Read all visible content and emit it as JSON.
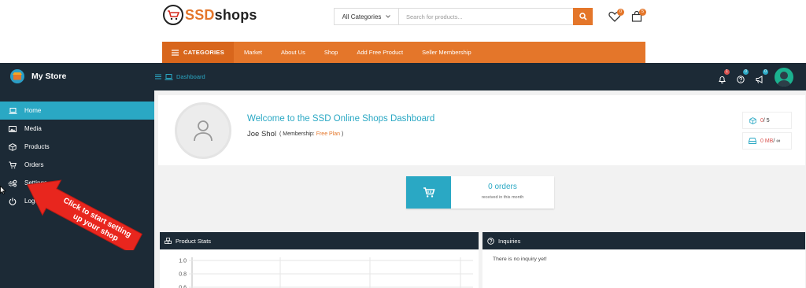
{
  "brand": {
    "part1": "SSD",
    "part2": "shops"
  },
  "search": {
    "category": "All Categories",
    "placeholder": "Search for products..."
  },
  "header_icons": [
    {
      "name": "wishlist-heart-icon",
      "badge": "0"
    },
    {
      "name": "cart-bag-icon",
      "badge": "5"
    }
  ],
  "nav": {
    "categories_label": "CATEGORIES",
    "items": [
      "Market",
      "About Us",
      "Shop",
      "Add Free Product",
      "Seller Membership"
    ]
  },
  "app": {
    "store_name": "My Store",
    "breadcrumb": "Dashboard",
    "notification_icons": [
      {
        "name": "bell-icon",
        "badge": "1",
        "color": "#d9534f"
      },
      {
        "name": "help-icon",
        "badge": "0",
        "color": "#2aa8c4"
      },
      {
        "name": "megaphone-icon",
        "badge": "0",
        "color": "#2aa8c4"
      }
    ]
  },
  "sidebar": {
    "items": [
      {
        "label": "Home",
        "icon": "laptop-icon",
        "active": true
      },
      {
        "label": "Media",
        "icon": "image-icon"
      },
      {
        "label": "Products",
        "icon": "box-icon"
      },
      {
        "label": "Orders",
        "icon": "cart-icon"
      },
      {
        "label": "Settings",
        "icon": "gears-icon"
      },
      {
        "label": "Logout",
        "icon": "power-icon"
      }
    ]
  },
  "callout": {
    "line1": "Click to start setting",
    "line2": "up your shop"
  },
  "welcome": {
    "title": "Welcome to the SSD Online Shops Dashboard",
    "name": "Joe Shol",
    "membership_prefix": "( Membership: ",
    "plan": "Free Plan",
    "membership_suffix": " )"
  },
  "stats": {
    "products_used": "0",
    "products_total": " / 5",
    "storage_used": "0 MB",
    "storage_total": " / ∞"
  },
  "orders": {
    "count": "0 orders",
    "subtitle": "received in this month"
  },
  "product_stats": {
    "title": "Product Stats"
  },
  "inquiries": {
    "title": "Inquiries",
    "empty_text": "There is no inquiry yet!"
  },
  "chart_data": {
    "type": "line",
    "y_ticks": [
      "1.0",
      "0.8",
      "0.6"
    ],
    "ylim": [
      0,
      1.0
    ],
    "series": []
  },
  "colors": {
    "accent": "#e4762a",
    "teal": "#2aa8c4",
    "dark": "#1c2a36",
    "callout": "#e8261e"
  }
}
